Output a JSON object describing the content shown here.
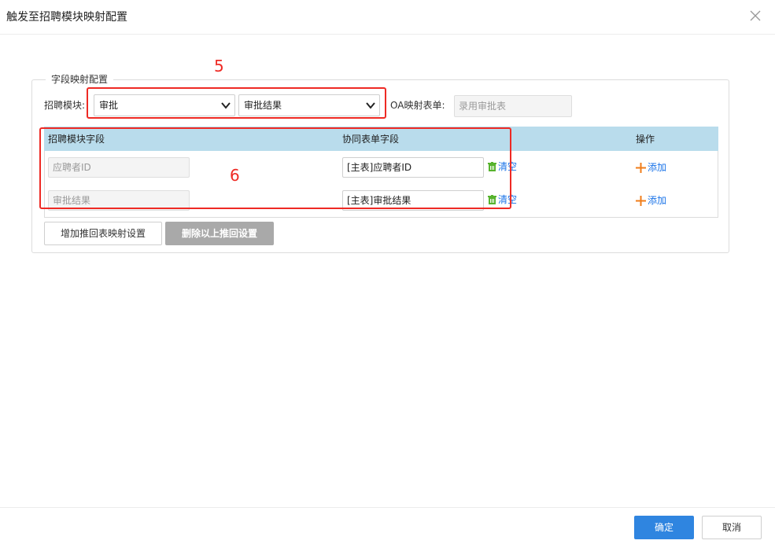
{
  "dialog": {
    "title": "触发至招聘模块映射配置"
  },
  "section": {
    "legend": "字段映射配置",
    "module_label": "招聘模块:",
    "module_select_1": "审批",
    "module_select_2": "审批结果",
    "oa_label": "OA映射表单:",
    "oa_value": "录用审批表"
  },
  "table": {
    "headers": [
      "招聘模块字段",
      "协同表单字段",
      "操作"
    ],
    "rows": [
      {
        "recruit_field": "应聘者ID",
        "form_field": "[主表]应聘者ID",
        "clear": "清空",
        "add": "添加"
      },
      {
        "recruit_field": "审批结果",
        "form_field": "[主表]审批结果",
        "clear": "清空",
        "add": "添加"
      }
    ]
  },
  "actions": {
    "add_push_back": "增加推回表映射设置",
    "delete_push_back": "删除以上推回设置"
  },
  "footer": {
    "confirm": "确定",
    "cancel": "取消"
  },
  "annotations": [
    "5",
    "6"
  ],
  "colors": {
    "header_bg": "#b9dcec",
    "primary": "#2f85e0",
    "annotation": "#ee2a24",
    "link": "#1a73e8"
  }
}
